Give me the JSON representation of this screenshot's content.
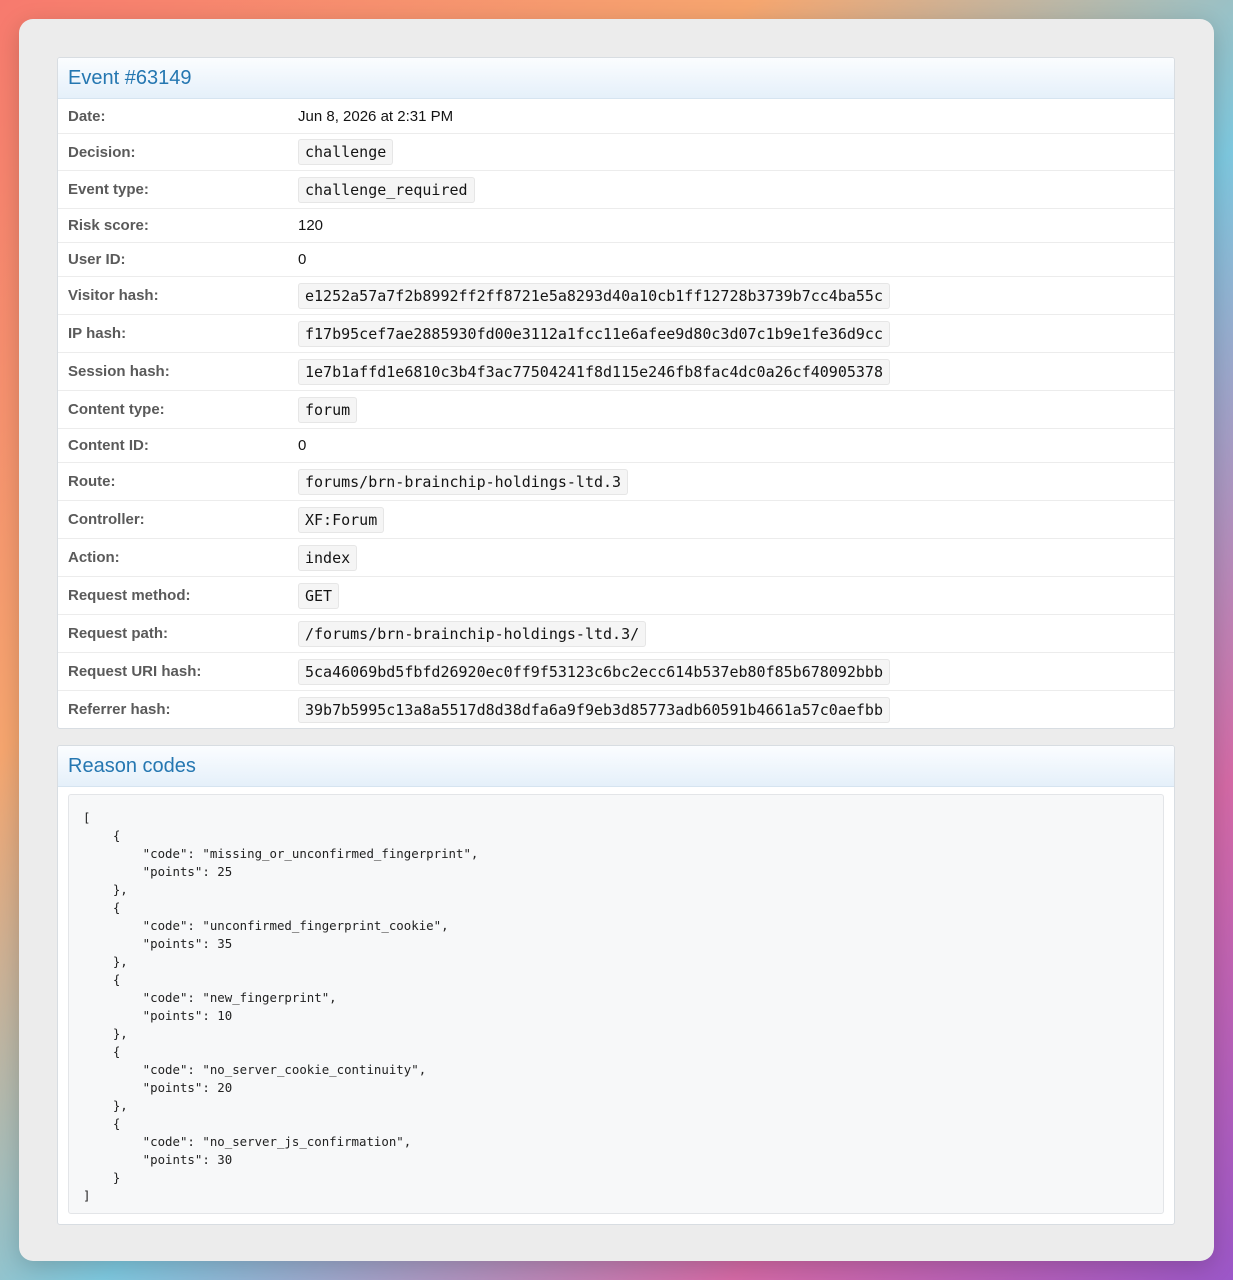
{
  "event": {
    "title": "Event #63149",
    "rows": [
      {
        "label": "Date:",
        "value": "Jun 8, 2026 at 2:31 PM",
        "code": false
      },
      {
        "label": "Decision:",
        "value": "challenge",
        "code": true
      },
      {
        "label": "Event type:",
        "value": "challenge_required",
        "code": true
      },
      {
        "label": "Risk score:",
        "value": "120",
        "code": false
      },
      {
        "label": "User ID:",
        "value": "0",
        "code": false
      },
      {
        "label": "Visitor hash:",
        "value": "e1252a57a7f2b8992ff2ff8721e5a8293d40a10cb1ff12728b3739b7cc4ba55c",
        "code": true
      },
      {
        "label": "IP hash:",
        "value": "f17b95cef7ae2885930fd00e3112a1fcc11e6afee9d80c3d07c1b9e1fe36d9cc",
        "code": true
      },
      {
        "label": "Session hash:",
        "value": "1e7b1affd1e6810c3b4f3ac77504241f8d115e246fb8fac4dc0a26cf40905378",
        "code": true
      },
      {
        "label": "Content type:",
        "value": "forum",
        "code": true
      },
      {
        "label": "Content ID:",
        "value": "0",
        "code": false
      },
      {
        "label": "Route:",
        "value": "forums/brn-brainchip-holdings-ltd.3",
        "code": true
      },
      {
        "label": "Controller:",
        "value": "XF:Forum",
        "code": true
      },
      {
        "label": "Action:",
        "value": "index",
        "code": true
      },
      {
        "label": "Request method:",
        "value": "GET",
        "code": true
      },
      {
        "label": "Request path:",
        "value": "/forums/brn-brainchip-holdings-ltd.3/",
        "code": true
      },
      {
        "label": "Request URI hash:",
        "value": "5ca46069bd5fbfd26920ec0ff9f53123c6bc2ecc614b537eb80f85b678092bbb",
        "code": true
      },
      {
        "label": "Referrer hash:",
        "value": "39b7b5995c13a8a5517d8d38dfa6a9f9eb3d85773adb60591b4661a57c0aefbb",
        "code": true
      }
    ]
  },
  "reasons": {
    "title": "Reason codes",
    "json_text": "[\n    {\n        \"code\": \"missing_or_unconfirmed_fingerprint\",\n        \"points\": 25\n    },\n    {\n        \"code\": \"unconfirmed_fingerprint_cookie\",\n        \"points\": 35\n    },\n    {\n        \"code\": \"new_fingerprint\",\n        \"points\": 10\n    },\n    {\n        \"code\": \"no_server_cookie_continuity\",\n        \"points\": 20\n    },\n    {\n        \"code\": \"no_server_js_confirmation\",\n        \"points\": 30\n    }\n]"
  }
}
